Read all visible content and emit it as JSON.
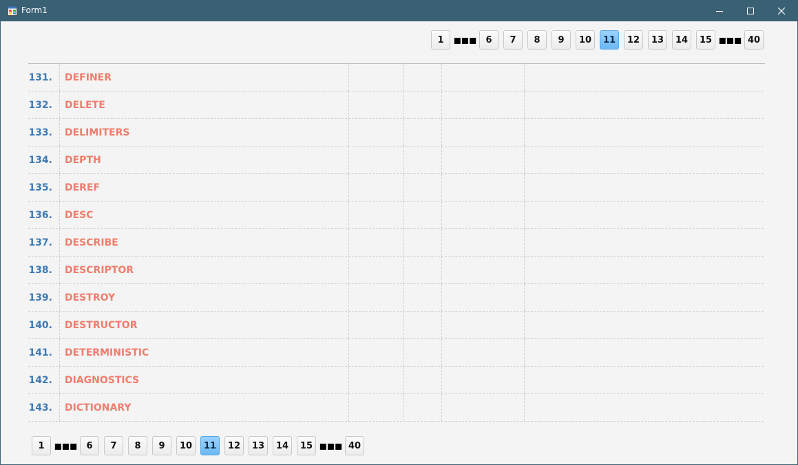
{
  "window": {
    "title": "Form1"
  },
  "pager": {
    "buttons": [
      "1",
      "...",
      "6",
      "7",
      "8",
      "9",
      "10",
      "11",
      "12",
      "13",
      "14",
      "15",
      "...",
      "40"
    ],
    "current": "11"
  },
  "rows": [
    {
      "num": "131.",
      "name": "DEFINER"
    },
    {
      "num": "132.",
      "name": "DELETE"
    },
    {
      "num": "133.",
      "name": "DELIMITERS"
    },
    {
      "num": "134.",
      "name": "DEPTH"
    },
    {
      "num": "135.",
      "name": "DEREF"
    },
    {
      "num": "136.",
      "name": "DESC"
    },
    {
      "num": "137.",
      "name": "DESCRIBE"
    },
    {
      "num": "138.",
      "name": "DESCRIPTOR"
    },
    {
      "num": "139.",
      "name": "DESTROY"
    },
    {
      "num": "140.",
      "name": "DESTRUCTOR"
    },
    {
      "num": "141.",
      "name": "DETERMINISTIC"
    },
    {
      "num": "142.",
      "name": "DIAGNOSTICS"
    },
    {
      "num": "143.",
      "name": "DICTIONARY"
    }
  ],
  "colors": {
    "titlebar": "#3a6073",
    "number": "#3d7ab5",
    "name": "#f07d6c",
    "active_page": "#7cc4fa"
  }
}
